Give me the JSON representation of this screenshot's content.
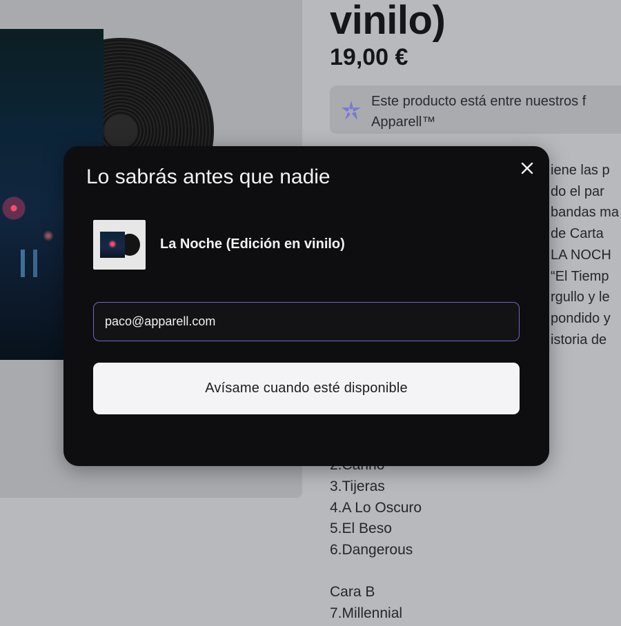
{
  "product": {
    "title": "vinilo)",
    "price": "19,00 €",
    "favorite_text": [
      "Este producto está entre nuestros f",
      "Apparell™"
    ],
    "description_lines": [
      "iene las p",
      "do el par",
      "bandas ma",
      "de Carta",
      "LA NOCH",
      "“El Tiemp",
      "rgullo y le",
      "pondido y",
      "istoria de"
    ],
    "tracklist": [
      "2.Cariño",
      "3.Tijeras",
      "4.A Lo Oscuro",
      "5.El Beso",
      "6.Dangerous",
      "",
      "Cara B",
      "7.Millennial"
    ]
  },
  "modal": {
    "title": "Lo sabrás antes que nadie",
    "close_icon": "close-icon",
    "product_name": "La Noche (Edición en vinilo)",
    "email_value": "paco@apparell.com",
    "submit_label": "Avísame cuando esté disponible"
  },
  "colors": {
    "modal_bg": "#0e0e10",
    "input_border": "#6c68c4",
    "button_bg": "#f4f4f6",
    "favorite_icon": "#7b78d6"
  }
}
